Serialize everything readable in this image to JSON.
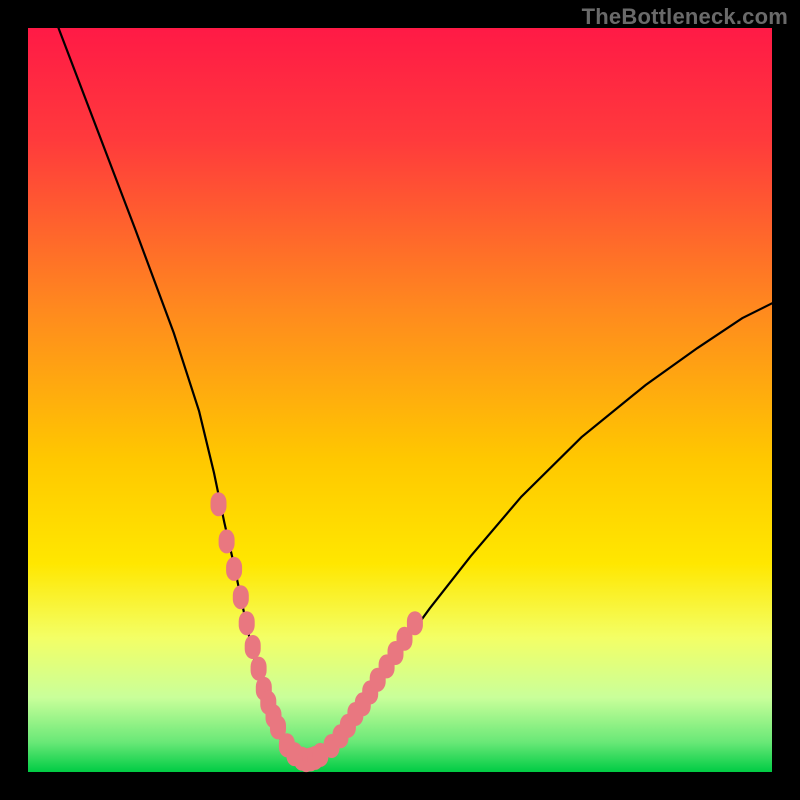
{
  "watermark": "TheBottleneck.com",
  "colors": {
    "bg_black": "#000000",
    "grad_top": "#ff1a46",
    "grad_mid": "#ffd400",
    "grad_green_pale": "#c9ff9a",
    "grad_green_strong": "#00cc44",
    "curve_stroke": "#000000",
    "marker_fill": "#e97780",
    "watermark": "#6a6a6a"
  },
  "chart_data": {
    "type": "line",
    "title": "",
    "xlabel": "",
    "ylabel": "",
    "xlim": [
      0,
      100
    ],
    "ylim": [
      0,
      100
    ],
    "grid": false,
    "x": [
      4.1,
      14.4,
      19.6,
      23.0,
      25.0,
      26.4,
      27.7,
      28.7,
      29.6,
      30.4,
      31.2,
      32.0,
      32.6,
      33.3,
      34.0,
      34.6,
      35.3,
      36.0,
      36.7,
      37.4,
      38.2,
      39.0,
      39.9,
      40.9,
      42.0,
      43.3,
      45.0,
      47.2,
      50.0,
      54.0,
      59.5,
      66.3,
      74.4,
      83.0,
      90.0,
      96.0,
      100.0
    ],
    "y": [
      100.0,
      73.0,
      59.0,
      48.5,
      40.2,
      33.5,
      27.8,
      23.0,
      18.8,
      15.2,
      12.1,
      9.5,
      7.4,
      5.7,
      4.3,
      3.3,
      2.5,
      2.0,
      1.7,
      1.6,
      1.7,
      2.0,
      2.6,
      3.5,
      4.8,
      6.6,
      9.1,
      12.4,
      16.5,
      22.0,
      29.0,
      37.0,
      45.0,
      52.0,
      57.0,
      61.0,
      63.0
    ],
    "series": [
      {
        "name": "bottleneck-curve",
        "style": "line"
      },
      {
        "name": "data-markers",
        "style": "points",
        "points_x": [
          25.6,
          26.7,
          27.7,
          28.6,
          29.4,
          30.2,
          31.0,
          31.7,
          32.3,
          33.0,
          33.6,
          34.8,
          35.8,
          36.8,
          37.4,
          38.0,
          38.6,
          39.3,
          40.8,
          42.0,
          43.0,
          44.0,
          45.0,
          46.0,
          47.0,
          48.2,
          49.4,
          50.6,
          52.0
        ],
        "points_y": [
          36.0,
          31.0,
          27.3,
          23.5,
          20.0,
          16.8,
          13.9,
          11.2,
          9.3,
          7.5,
          6.0,
          3.6,
          2.4,
          1.8,
          1.6,
          1.7,
          1.9,
          2.3,
          3.5,
          4.8,
          6.2,
          7.8,
          9.1,
          10.7,
          12.4,
          14.2,
          16.0,
          17.9,
          20.0
        ]
      }
    ]
  }
}
